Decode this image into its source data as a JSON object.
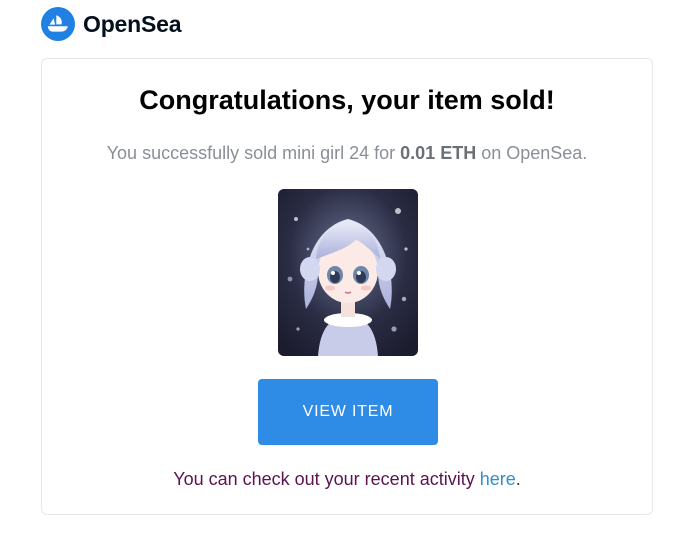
{
  "brand": {
    "name": "OpenSea",
    "logo_icon": "opensea-logo-icon",
    "color": "#2081e2"
  },
  "email": {
    "headline": "Congratulations, your item sold!",
    "message": {
      "prefix": "You successfully sold mini girl 24 for ",
      "amount": "0.01 ETH",
      "suffix": " on OpenSea."
    },
    "item_image": {
      "icon": "nft-artwork-image"
    },
    "button_label": "VIEW ITEM",
    "footer": {
      "text": "You can check out your recent activity ",
      "link_label": "here",
      "end": "."
    }
  },
  "colors": {
    "button": "#2e8be6",
    "link": "#2f8fd0",
    "footer_text": "#5a1450",
    "muted_text": "#8a8f96"
  }
}
